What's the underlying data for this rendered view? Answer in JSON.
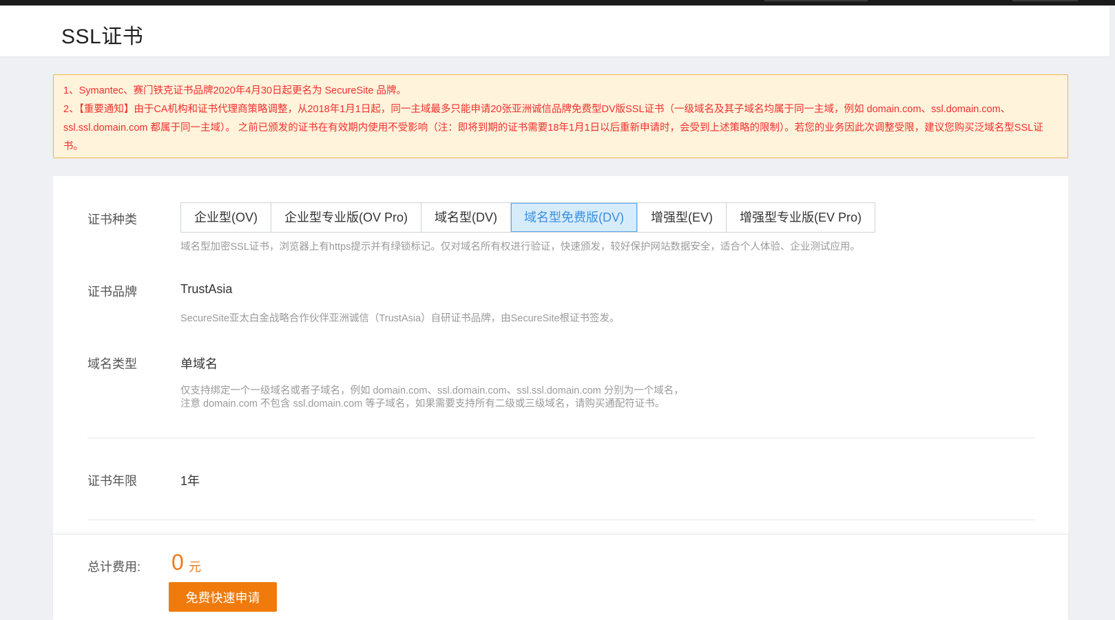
{
  "header": {
    "title": "SSL证书"
  },
  "notice": {
    "color": "#f0302c",
    "background": "#fff3dc",
    "lines": [
      "1、Symantec、赛门铁克证书品牌2020年4月30日起更名为 SecureSite 品牌。",
      "2、【重要通知】由于CA机构和证书代理商策略调整，从2018年1月1日起，同一主域最多只能申请20张亚洲诚信品牌免费型DV版SSL证书（一级域名及其子域名均属于同一主域，例如 domain.com、ssl.domain.com、ssl.ssl.domain.com 都属于同一主域）。 之前已颁发的证书在有效期内使用不受影响（注：即将到期的证书需要18年1月1日以后重新申请时，会受到上述策略的限制）。若您的业务因此次调整受限，建议您购买泛域名型SSL证书。"
    ]
  },
  "cert_type": {
    "label": "证书种类",
    "tabs": [
      {
        "label": "企业型(OV)",
        "active": false
      },
      {
        "label": "企业型专业版(OV Pro)",
        "active": false
      },
      {
        "label": "域名型(DV)",
        "active": false
      },
      {
        "label": "域名型免费版(DV)",
        "active": true
      },
      {
        "label": "增强型(EV)",
        "active": false
      },
      {
        "label": "增强型专业版(EV Pro)",
        "active": false
      }
    ],
    "description": "域名型加密SSL证书，浏览器上有https提示并有绿锁标记。仅对域名所有权进行验证，快速颁发，较好保护网站数据安全，适合个人体验、企业测试应用。"
  },
  "cert_brand": {
    "label": "证书品牌",
    "value": "TrustAsia",
    "description": "SecureSite亚太白金战略合作伙伴亚洲诚信（TrustAsia）自研证书品牌，由SecureSite根证书签发。"
  },
  "domain_type": {
    "label": "域名类型",
    "value": "单域名",
    "description_line1": "仅支持绑定一个一级域名或者子域名，例如 domain.com、ssl.domain.com、ssl.ssl.domain.com 分别为一个域名，",
    "description_line2": "注意 domain.com 不包含 ssl.domain.com 等子域名，如果需要支持所有二级或三级域名，请购买通配符证书。"
  },
  "cert_term": {
    "label": "证书年限",
    "value": "1年"
  },
  "footer": {
    "total_label": "总计费用:",
    "amount": "0",
    "unit": "元",
    "apply_button": "免费快速申请",
    "accent_color": "#f07a0c"
  }
}
